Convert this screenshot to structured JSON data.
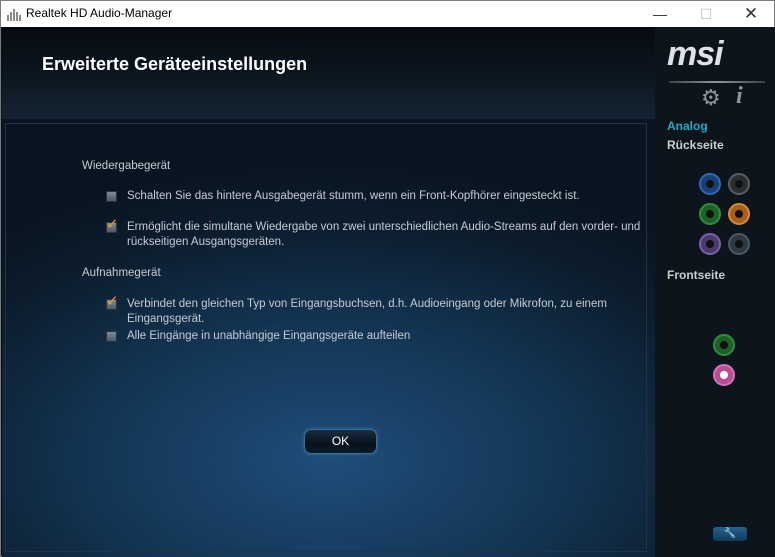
{
  "window": {
    "title": "Realtek HD Audio-Manager",
    "minimize": "—",
    "maximize": "☐",
    "close": "✕"
  },
  "header": {
    "title": "Erweiterte Geräteeinstellungen"
  },
  "playback": {
    "label": "Wiedergabegerät",
    "options": [
      {
        "text": "Schalten Sie das hintere Ausgabegerät stumm, wenn ein Front-Kopfhörer eingesteckt ist.",
        "checked": false
      },
      {
        "text": "Ermöglicht die simultane Wiedergabe von zwei unterschiedlichen Audio-Streams auf den vorder- und rückseitigen Ausgangsgeräten.",
        "checked": true
      }
    ]
  },
  "recording": {
    "label": "Aufnahmegerät",
    "options": [
      {
        "text": "Verbindet den gleichen Typ von Eingangsbuchsen, d.h. Audioeingang oder Mikrofon, zu einem Eingangsgerät.",
        "checked": true
      },
      {
        "text": "Alle Eingänge in unabhängige Eingangsgeräte aufteilen",
        "checked": false
      }
    ]
  },
  "ok_label": "OK",
  "side": {
    "logo": "msi",
    "section": "Analog",
    "rear_label": "Rückseite",
    "front_label": "Frontseite",
    "rear_jacks": [
      "blue",
      "black",
      "green",
      "orange",
      "purple",
      "grey"
    ],
    "front_jacks": [
      "green",
      "pink"
    ],
    "icons": [
      "gear-icon",
      "info-icon",
      "wrench-icon"
    ]
  },
  "colors": {
    "accent": "#29a8c7",
    "check": "#f39a1e"
  }
}
